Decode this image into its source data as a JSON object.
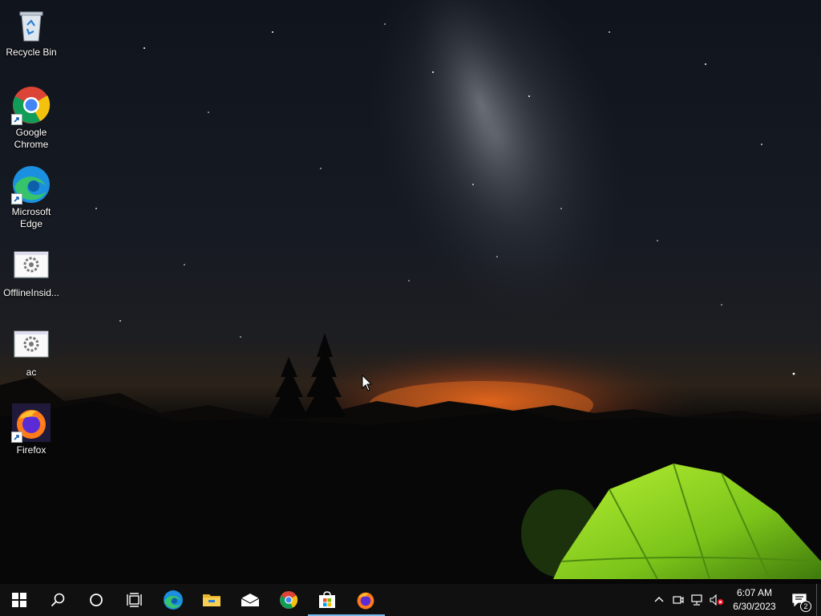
{
  "desktop": {
    "icons": [
      {
        "label": "Recycle Bin",
        "icon": "recycle-bin-icon"
      },
      {
        "label": "Google Chrome",
        "icon": "chrome-icon"
      },
      {
        "label": "Microsoft Edge",
        "icon": "edge-icon"
      },
      {
        "label": "OfflineInsid...",
        "icon": "app-settings-icon"
      },
      {
        "label": "ac",
        "icon": "app-settings-icon"
      },
      {
        "label": "Firefox",
        "icon": "firefox-icon"
      }
    ]
  },
  "taskbar": {
    "buttons": [
      {
        "name": "start",
        "icon": "windows-logo-icon"
      },
      {
        "name": "search",
        "icon": "search-icon"
      },
      {
        "name": "cortana",
        "icon": "cortana-circle-icon"
      },
      {
        "name": "task-view",
        "icon": "task-view-icon"
      },
      {
        "name": "edge",
        "icon": "edge-icon"
      },
      {
        "name": "file-explorer",
        "icon": "folder-icon"
      },
      {
        "name": "mail",
        "icon": "mail-icon"
      },
      {
        "name": "chrome",
        "icon": "chrome-icon"
      },
      {
        "name": "microsoft-store",
        "icon": "store-icon",
        "active": true
      },
      {
        "name": "firefox",
        "icon": "firefox-icon",
        "active": true
      }
    ],
    "tray": {
      "time": "6:07 AM",
      "date": "6/30/2023",
      "notification_count": "2",
      "icons": [
        "chevron-up-icon",
        "meet-now-icon",
        "network-icon",
        "volume-muted-icon"
      ]
    }
  },
  "colors": {
    "taskbar": "#101010",
    "accent": "#76b9ed",
    "tent": "#8ed01f"
  }
}
